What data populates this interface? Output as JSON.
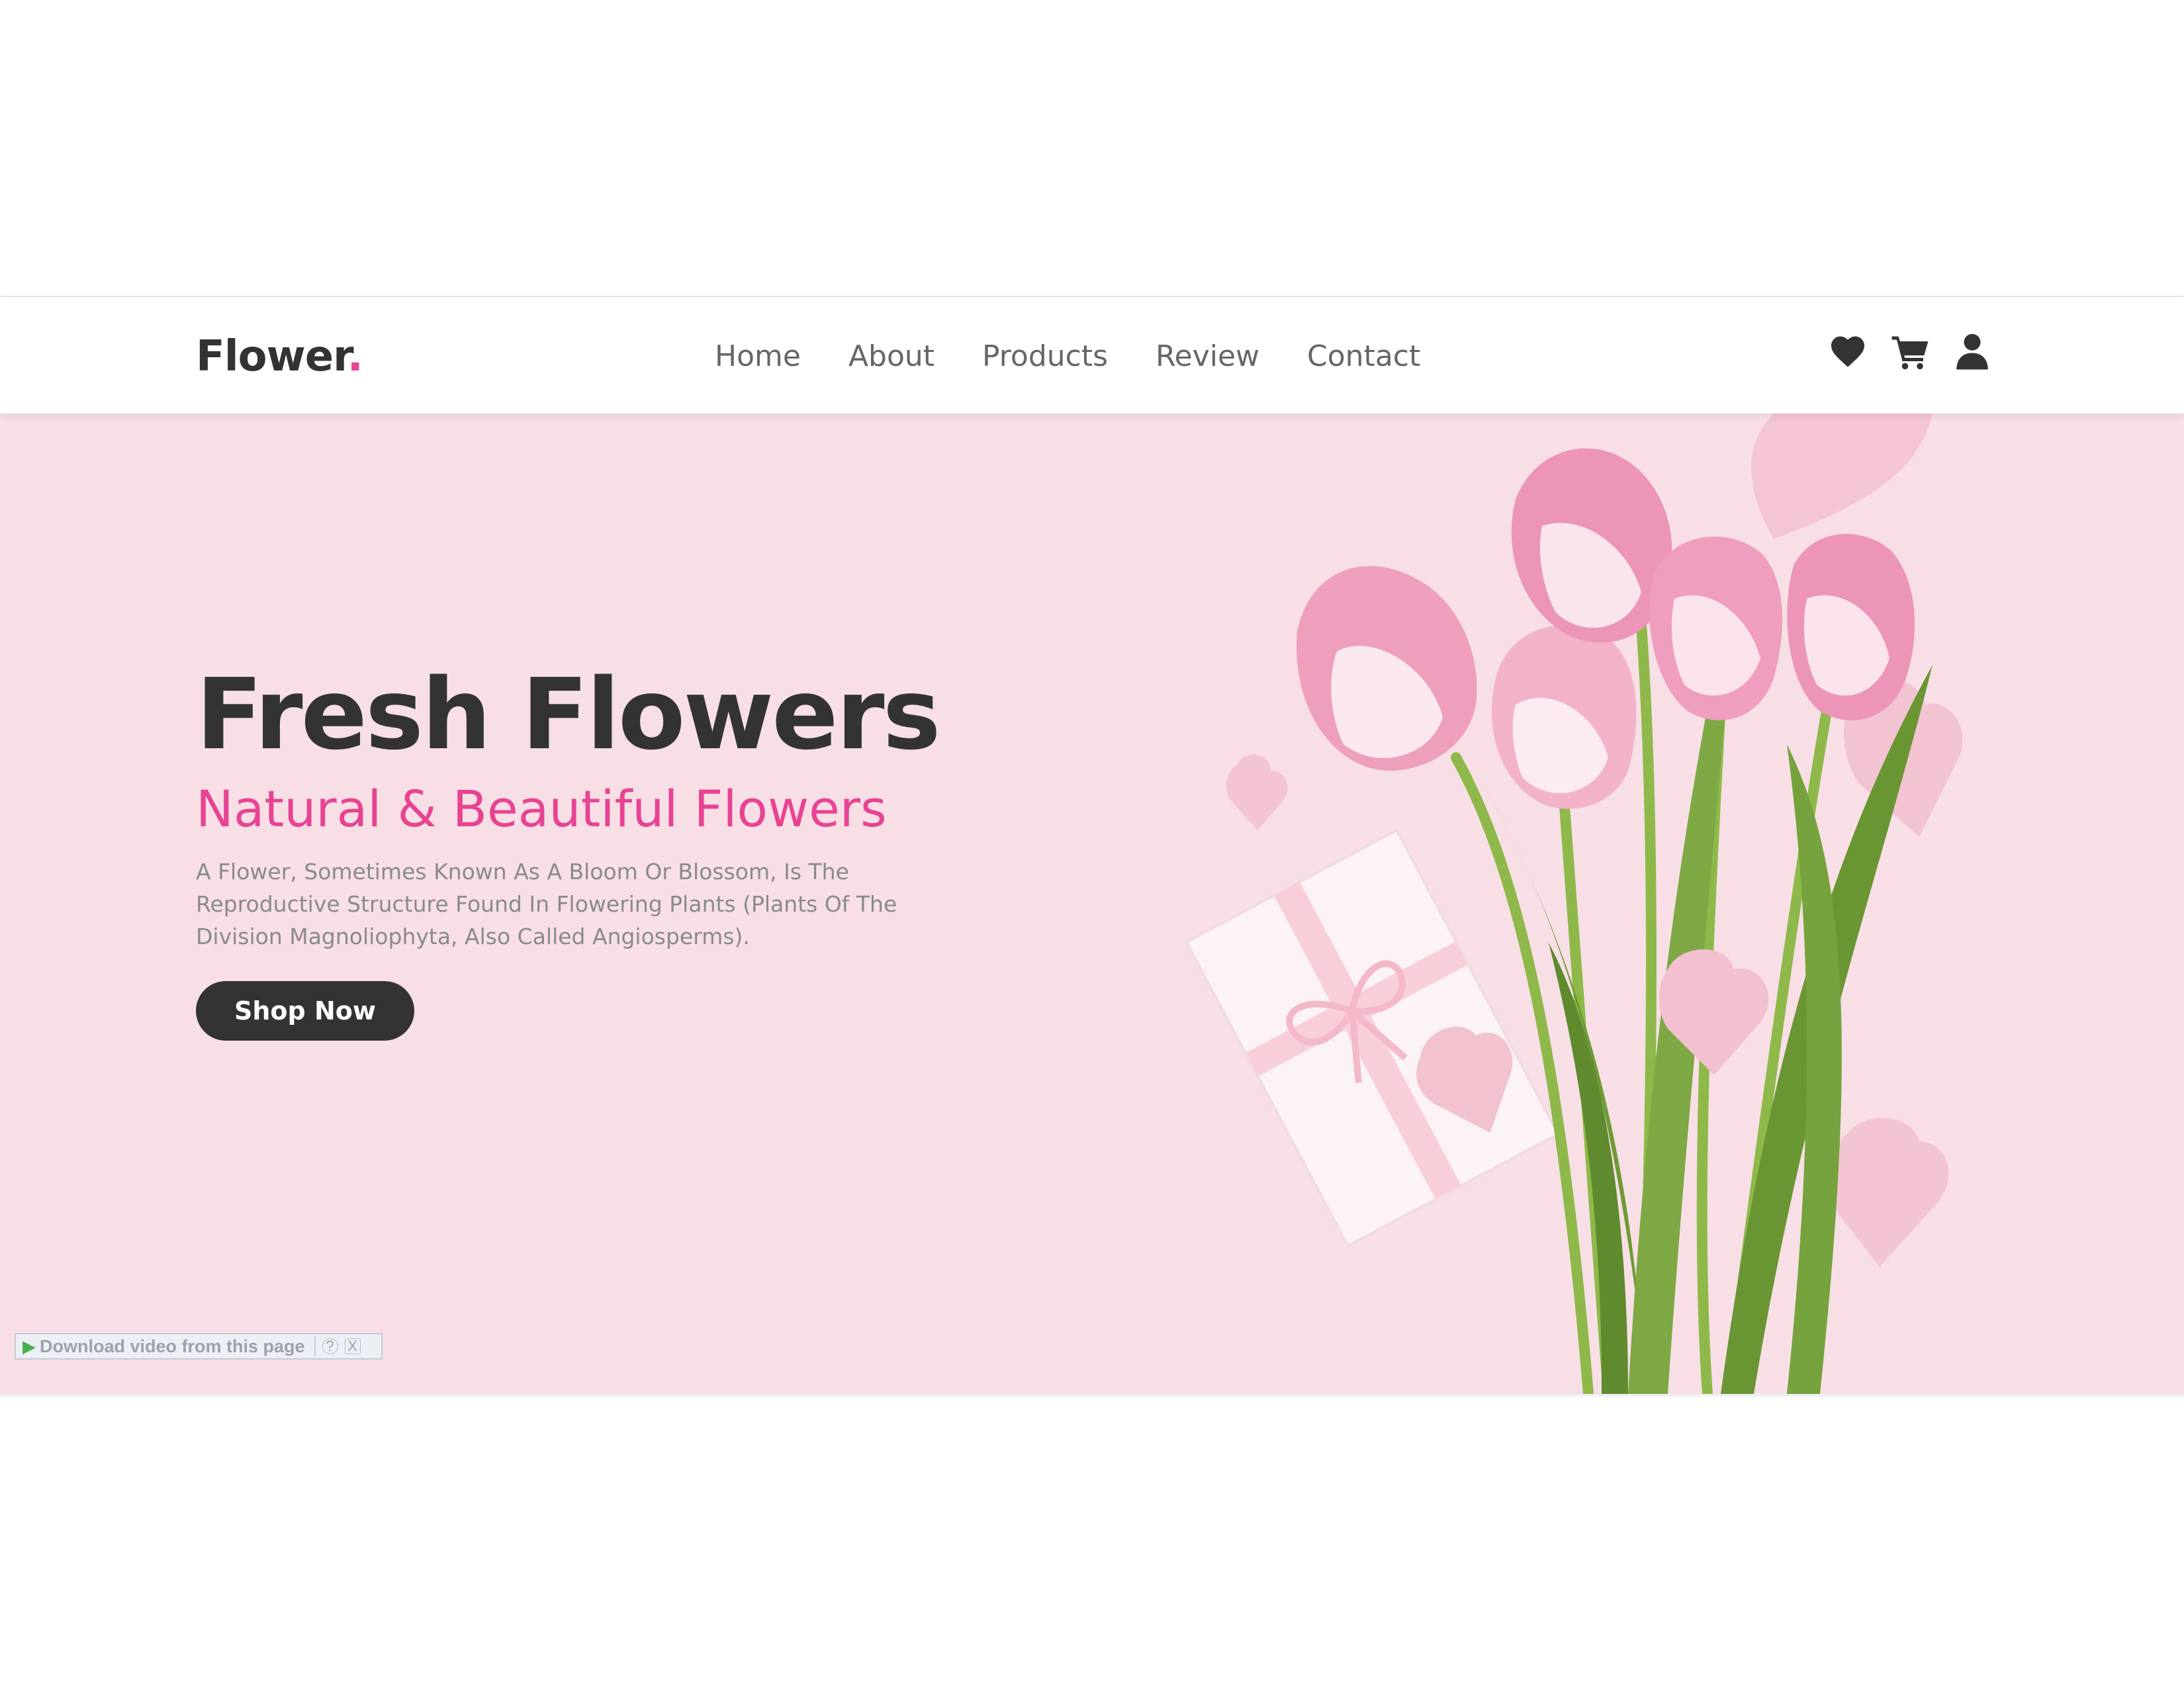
{
  "brand": {
    "name": "Flower",
    "dot": "."
  },
  "nav": {
    "links": [
      {
        "label": "Home"
      },
      {
        "label": "About"
      },
      {
        "label": "Products"
      },
      {
        "label": "Review"
      },
      {
        "label": "Contact"
      }
    ],
    "icons": [
      "heart-icon",
      "cart-icon",
      "user-icon"
    ]
  },
  "hero": {
    "title": "Fresh Flowers",
    "subtitle": "Natural & Beautiful Flowers",
    "description": "A Flower, Sometimes Known As A Bloom Or Blossom, Is The Reproductive Structure Found In Flowering Plants (Plants Of The Division Magnoliophyta, Also Called Angiosperms).",
    "button": "Shop Now",
    "image": "tulip-bouquet-with-gift-box-and-paper-hearts"
  },
  "download_bar": {
    "label": "Download video from this page",
    "help": "?",
    "close": "X"
  },
  "colors": {
    "accent": "#e84393",
    "dark": "#333333",
    "hero_bg": "#f7dfe5",
    "text_muted": "#8a8a8a"
  }
}
